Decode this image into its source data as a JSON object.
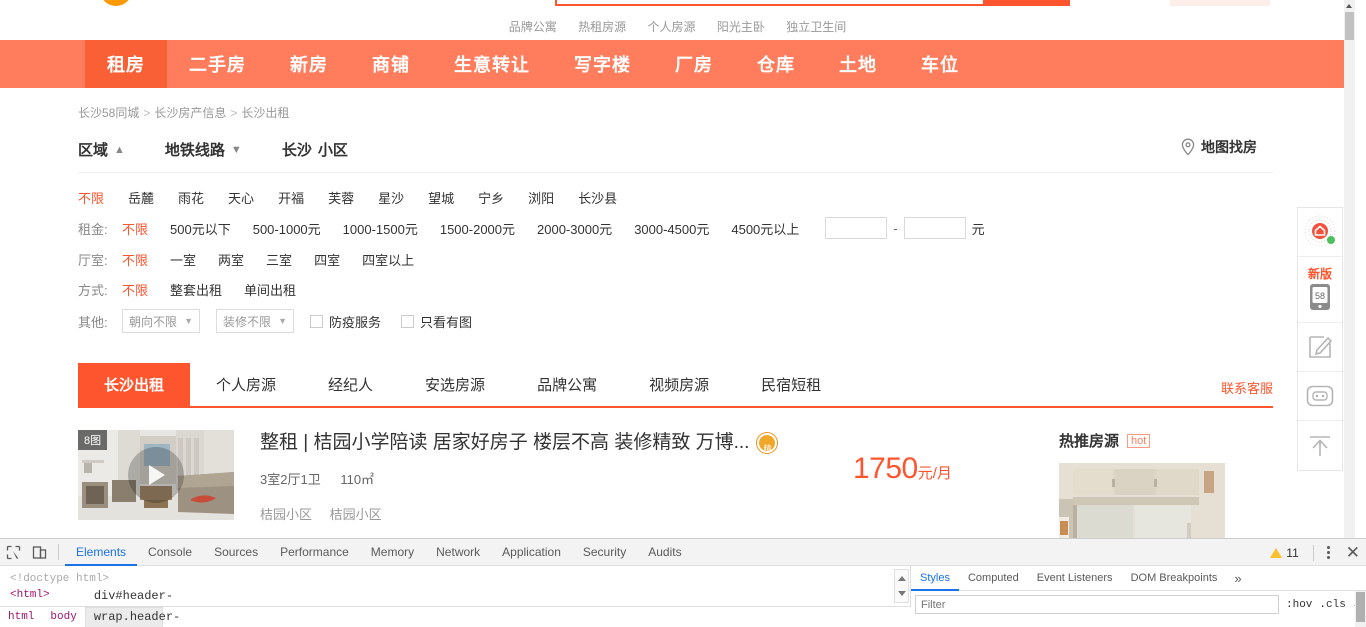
{
  "hotwords": [
    "品牌公寓",
    "热租房源",
    "个人房源",
    "阳光主卧",
    "独立卫生间"
  ],
  "mainnav": [
    {
      "label": "租房",
      "active": true
    },
    {
      "label": "二手房",
      "active": false
    },
    {
      "label": "新房",
      "active": false
    },
    {
      "label": "商铺",
      "active": false
    },
    {
      "label": "生意转让",
      "active": false
    },
    {
      "label": "写字楼",
      "active": false
    },
    {
      "label": "厂房",
      "active": false
    },
    {
      "label": "仓库",
      "active": false
    },
    {
      "label": "土地",
      "active": false
    },
    {
      "label": "车位",
      "active": false
    }
  ],
  "breadcrumb": [
    "长沙58同城",
    "长沙房产信息",
    "长沙出租"
  ],
  "filter_head": {
    "region": "区域",
    "subway": "地铁线路",
    "city": "长沙",
    "community": "小区",
    "map_label": "地图找房"
  },
  "filters": {
    "areas": [
      "不限",
      "岳麓",
      "雨花",
      "天心",
      "开福",
      "芙蓉",
      "星沙",
      "望城",
      "宁乡",
      "浏阳",
      "长沙县"
    ],
    "rent_label": "租金:",
    "rent": [
      "不限",
      "500元以下",
      "500-1000元",
      "1000-1500元",
      "1500-2000元",
      "2000-3000元",
      "3000-4500元",
      "4500元以上"
    ],
    "rent_min_value": "",
    "rent_max_value": "",
    "rent_dash": "-",
    "rent_unit": "元",
    "rooms_label": "厅室:",
    "rooms": [
      "不限",
      "一室",
      "两室",
      "三室",
      "四室",
      "四室以上"
    ],
    "mode_label": "方式:",
    "modes": [
      "不限",
      "整套出租",
      "单间出租"
    ],
    "other_label": "其他:",
    "select_orientation": "朝向不限",
    "select_decoration": "装修不限",
    "check_epidemic": "防疫服务",
    "check_haspic": "只看有图"
  },
  "listing_tabs": [
    {
      "label": "长沙出租",
      "active": true
    },
    {
      "label": "个人房源",
      "active": false
    },
    {
      "label": "经纪人",
      "active": false
    },
    {
      "label": "安选房源",
      "active": false
    },
    {
      "label": "品牌公寓",
      "active": false
    },
    {
      "label": "视频房源",
      "active": false
    },
    {
      "label": "民宿短租",
      "active": false
    }
  ],
  "contact_service": "联系客服",
  "listing": {
    "photo_badge": "8图",
    "title": "整租 | 桔园小学陪读 居家好房子 楼层不高 装修精致 万博...",
    "layout": "3室2厅1卫",
    "area": "110㎡",
    "tags": [
      "桔园小区",
      "桔园小区"
    ],
    "price": "1750",
    "price_unit": "元/月"
  },
  "hot_panel": {
    "title": "热推房源",
    "badge": "hot"
  },
  "float_tools": {
    "items": [
      {
        "name": "qrcode-house-icon"
      },
      {
        "name": "app-58-icon",
        "label": "新版"
      },
      {
        "name": "feedback-edit-icon"
      },
      {
        "name": "robot-chat-icon"
      },
      {
        "name": "back-to-top-icon"
      }
    ]
  },
  "devtools": {
    "tabs": [
      "Elements",
      "Console",
      "Sources",
      "Performance",
      "Memory",
      "Network",
      "Application",
      "Security",
      "Audits"
    ],
    "active_tab": "Elements",
    "warning_count": "11",
    "dom": {
      "doctype": "<!doctype html>",
      "html_tag": "<html>"
    },
    "breadcrumbs": [
      "html",
      "body",
      "div#header-wrap.header-wrap"
    ],
    "styles_tabs": [
      "Styles",
      "Computed",
      "Event Listeners",
      "DOM Breakpoints"
    ],
    "styles_active": "Styles",
    "styles_more": "»",
    "filter_placeholder": "Filter",
    "hov_label": ":hov",
    "cls_label": ".cls",
    "plus_label": "+",
    "close_label": "✕"
  },
  "colors": {
    "brand_orange": "#ff552e",
    "nav_orange": "#ff7d5c",
    "nav_active": "#f96035",
    "devtools_blue": "#1a73e8"
  }
}
